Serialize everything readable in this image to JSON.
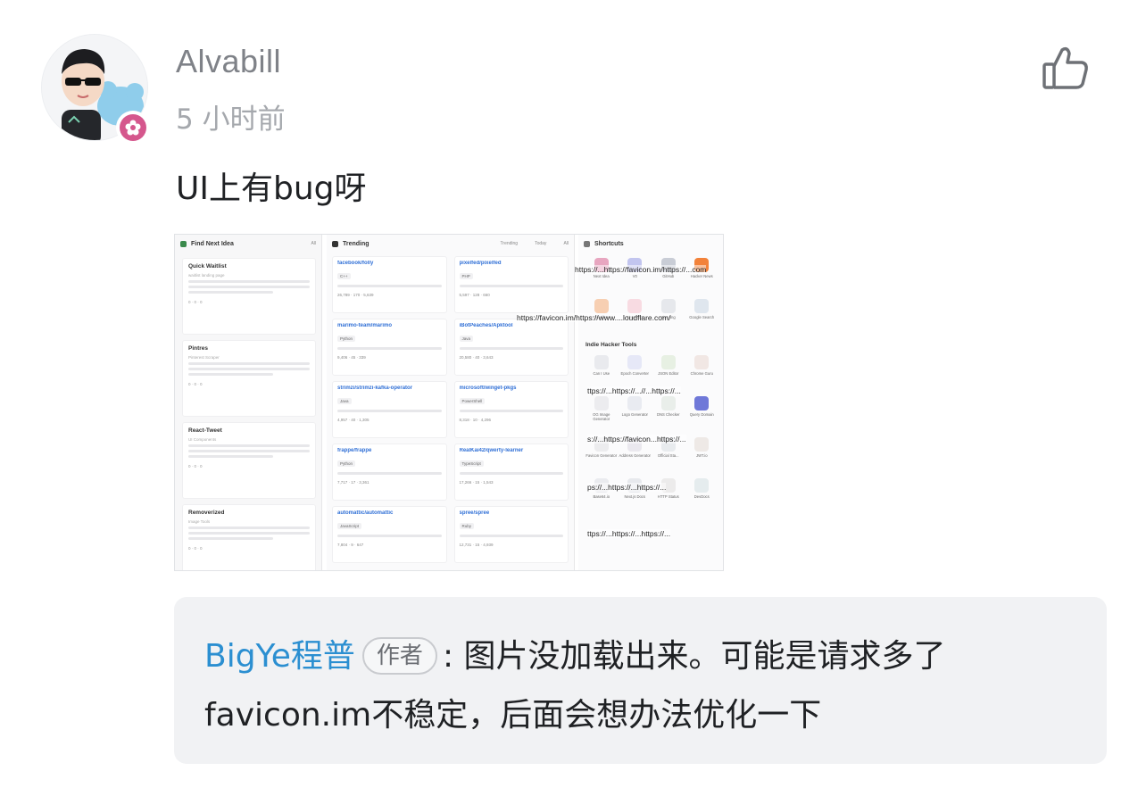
{
  "comment": {
    "username": "Alvabill",
    "time": "5 小时前",
    "text": "UI上有bug呀",
    "like_icon": "thumbs-up-icon",
    "avatar_icon": "user-avatar",
    "badge_icon": "flower-badge-icon"
  },
  "screenshot": {
    "left_panel": {
      "title": "Find Next Idea",
      "filter": "All",
      "cards": [
        {
          "title": "Quick Waitlist",
          "sub": "waitlist landing page",
          "meta": "0 · 0 · 0"
        },
        {
          "title": "Pintres",
          "sub": "Pinterest Scraper",
          "meta": "0 · 0 · 0"
        },
        {
          "title": "React-Tweet",
          "sub": "UI Components",
          "meta": "0 · 0 · 0"
        },
        {
          "title": "Removerized",
          "sub": "Image Tools",
          "meta": "0 · 0 · 0"
        }
      ]
    },
    "trending": {
      "title": "Trending",
      "filters": [
        "Trending",
        "Today",
        "All"
      ],
      "repos": [
        {
          "name": "facebook/folly",
          "tag": "C++",
          "stats": "26,789 · 170 · 5,639"
        },
        {
          "name": "pixelfed/pixelfed",
          "tag": "PHP",
          "stats": "5,597 · 128 · 660"
        },
        {
          "name": "marimo-team/marimo",
          "tag": "Python",
          "stats": "9,406 · 45 · 339"
        },
        {
          "name": "iBotPeaches/Apktool",
          "tag": "Java",
          "stats": "20,580 · 40 · 3,643"
        },
        {
          "name": "strimzi/strimzi-kafka-operator",
          "tag": "Java",
          "stats": "4,957 · 40 · 1,305"
        },
        {
          "name": "microsoft/winget-pkgs",
          "tag": "PowerShell",
          "stats": "8,318 · 10 · 4,296"
        },
        {
          "name": "frappe/frappe",
          "tag": "Python",
          "stats": "7,717 · 17 · 3,361"
        },
        {
          "name": "RealKai42/qwerty-learner",
          "tag": "TypeScript",
          "stats": "17,266 · 15 · 1,543"
        },
        {
          "name": "automattic/automattic",
          "tag": "JavaScript",
          "stats": "7,804 · 9 · 647"
        },
        {
          "name": "spree/spree",
          "tag": "Ruby",
          "stats": "12,731 · 15 · 4,939"
        }
      ]
    },
    "shortcuts": {
      "title": "Shortcuts",
      "items": [
        {
          "label": "Next Idea",
          "color": "#e8a6c0"
        },
        {
          "label": "V0",
          "color": "#c2c5ef"
        },
        {
          "label": "GitHub",
          "color": "#c9cdd6"
        },
        {
          "label": "Hacker News",
          "color": "#f2823a"
        },
        {
          "label": "Cloudflare",
          "color": "#f7cfb2"
        },
        {
          "label": "Tiny PNG",
          "color": "#f8dbe2"
        },
        {
          "label": "Tiny Img",
          "color": "#e6e8ec"
        },
        {
          "label": "Google Search",
          "color": "#dfe6ee"
        }
      ],
      "indie_title": "Indie Hacker Tools",
      "tools": [
        {
          "label": "Can I Use",
          "color": "#e9eaee"
        },
        {
          "label": "Epoch Converter",
          "color": "#e6e8f7"
        },
        {
          "label": "JSON Editor",
          "color": "#e7f0e3"
        },
        {
          "label": "Chrome Guru",
          "color": "#f1e7e4"
        },
        {
          "label": "OG Image Generator",
          "color": "#ececef"
        },
        {
          "label": "Logo Generator",
          "color": "#e9ebf1"
        },
        {
          "label": "DNS Checker",
          "color": "#e9eeea"
        },
        {
          "label": "Query Domain",
          "color": "#6f78d8"
        },
        {
          "label": "Favicon Generator",
          "color": "#ececee"
        },
        {
          "label": "Address Generator",
          "color": "#eae8ee"
        },
        {
          "label": "Official Sta...",
          "color": "#e8ebee"
        },
        {
          "label": "JWT.io",
          "color": "#eee9e6"
        },
        {
          "label": "Base64.io",
          "color": "#eaebef"
        },
        {
          "label": "Next.js Docs",
          "color": "#e7e9ed"
        },
        {
          "label": "HTTP Status",
          "color": "#ecebeb"
        },
        {
          "label": "DevDocs",
          "color": "#e5ecee"
        }
      ]
    },
    "overlay_urls": [
      "https://...https://favicon.im/https://...com",
      "https://favicon.im/https://www....loudflare.com/",
      "ttps://...https://...//...https://...",
      "s://...https://favicon...https://...",
      "ps://...https://...https://...",
      "ttps://...https://...https://..."
    ]
  },
  "reply": {
    "author": "BigYe程普",
    "badge": "作者",
    "text": ": 图片没加载出来。可能是请求多了favicon.im不稳定，后面会想办法优化一下"
  }
}
